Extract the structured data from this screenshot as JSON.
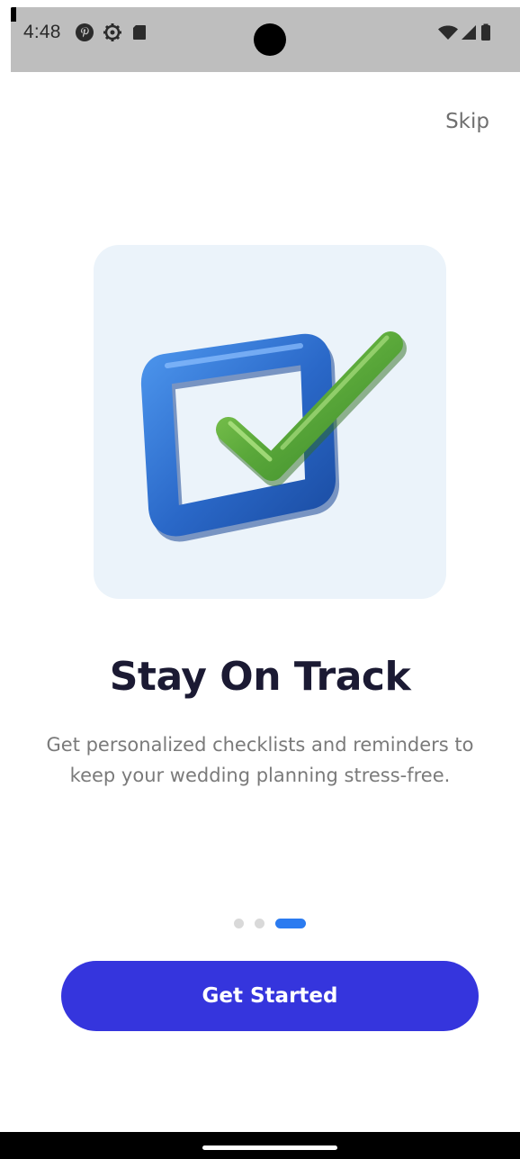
{
  "status_bar": {
    "time": "4:48",
    "left_icons": [
      "pinterest-icon",
      "settings-gear-icon",
      "sd-card-icon"
    ],
    "right_icons": [
      "wifi-icon",
      "cell-signal-icon",
      "battery-icon"
    ]
  },
  "onboarding": {
    "skip_label": "Skip",
    "illustration": "checkbox-checkmark-illustration",
    "title": "Stay On Track",
    "subtitle": "Get personalized checklists and reminders to keep your wedding planning stress-free.",
    "page_indicator": {
      "total": 3,
      "current": 3
    },
    "cta_label": "Get Started"
  },
  "colors": {
    "primary": "#3535dd",
    "indicator_active": "#2b7bf0",
    "indicator_inactive": "#d9d9d9",
    "title": "#1b1a33",
    "subtitle": "#7a7a7a",
    "card_bg": "#ebf3fa",
    "checkbox_blue": "#2a68c8",
    "check_green": "#5aa83a"
  }
}
